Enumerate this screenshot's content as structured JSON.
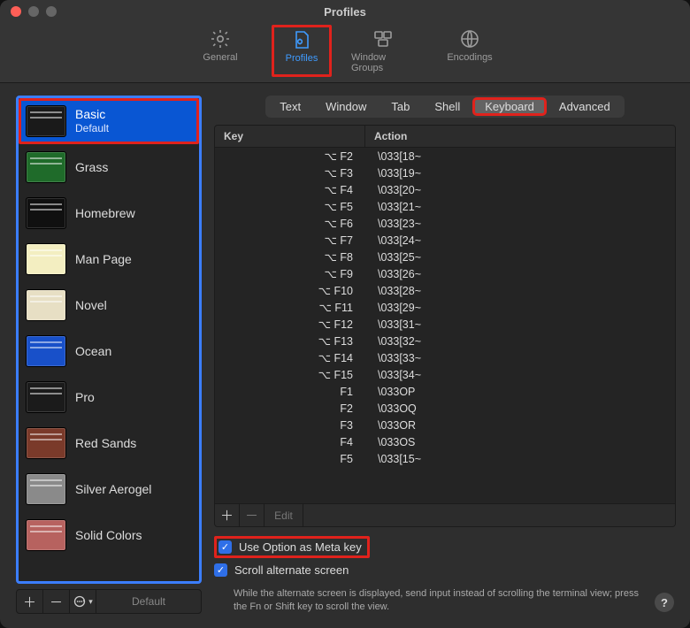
{
  "window": {
    "title": "Profiles"
  },
  "toolbar": [
    {
      "id": "general",
      "label": "General",
      "icon": "gear-icon",
      "active": false
    },
    {
      "id": "profiles",
      "label": "Profiles",
      "icon": "profile-icon",
      "active": true,
      "highlight": true
    },
    {
      "id": "window-groups",
      "label": "Window Groups",
      "icon": "wingroups-icon",
      "active": false
    },
    {
      "id": "encodings",
      "label": "Encodings",
      "icon": "globe-icon",
      "active": false
    }
  ],
  "profiles": [
    {
      "name": "Basic",
      "subtitle": "Default",
      "selected": true,
      "highlight": true,
      "thumb": "#1a1a1a"
    },
    {
      "name": "Grass",
      "thumb": "#1f6b2a"
    },
    {
      "name": "Homebrew",
      "thumb": "#101010"
    },
    {
      "name": "Man Page",
      "thumb": "#f3eec1"
    },
    {
      "name": "Novel",
      "thumb": "#e7dfc4"
    },
    {
      "name": "Ocean",
      "thumb": "#1850c9"
    },
    {
      "name": "Pro",
      "thumb": "#1b1b1b"
    },
    {
      "name": "Red Sands",
      "thumb": "#7a3a2a"
    },
    {
      "name": "Silver Aerogel",
      "thumb": "#8a8a8a"
    },
    {
      "name": "Solid Colors",
      "thumb": "#b7625f"
    }
  ],
  "listbar": {
    "default_label": "Default"
  },
  "tabs": [
    {
      "id": "text",
      "label": "Text"
    },
    {
      "id": "window",
      "label": "Window"
    },
    {
      "id": "tab",
      "label": "Tab"
    },
    {
      "id": "shell",
      "label": "Shell"
    },
    {
      "id": "keyboard",
      "label": "Keyboard",
      "active": true,
      "highlight": true
    },
    {
      "id": "advanced",
      "label": "Advanced"
    }
  ],
  "table": {
    "headers": {
      "key": "Key",
      "action": "Action"
    },
    "rows": [
      {
        "key": "⌥ F2",
        "action": "\\033[18~"
      },
      {
        "key": "⌥ F3",
        "action": "\\033[19~"
      },
      {
        "key": "⌥ F4",
        "action": "\\033[20~"
      },
      {
        "key": "⌥ F5",
        "action": "\\033[21~"
      },
      {
        "key": "⌥ F6",
        "action": "\\033[23~"
      },
      {
        "key": "⌥ F7",
        "action": "\\033[24~"
      },
      {
        "key": "⌥ F8",
        "action": "\\033[25~"
      },
      {
        "key": "⌥ F9",
        "action": "\\033[26~"
      },
      {
        "key": "⌥ F10",
        "action": "\\033[28~"
      },
      {
        "key": "⌥ F11",
        "action": "\\033[29~"
      },
      {
        "key": "⌥ F12",
        "action": "\\033[31~"
      },
      {
        "key": "⌥ F13",
        "action": "\\033[32~"
      },
      {
        "key": "⌥ F14",
        "action": "\\033[33~"
      },
      {
        "key": "⌥ F15",
        "action": "\\033[34~"
      },
      {
        "key": "F1",
        "action": "\\033OP"
      },
      {
        "key": "F2",
        "action": "\\033OQ"
      },
      {
        "key": "F3",
        "action": "\\033OR"
      },
      {
        "key": "F4",
        "action": "\\033OS"
      },
      {
        "key": "F5",
        "action": "\\033[15~"
      }
    ],
    "footer": {
      "edit_label": "Edit"
    }
  },
  "options": {
    "meta": {
      "label": "Use Option as Meta key",
      "checked": true,
      "highlight": true
    },
    "scroll": {
      "label": "Scroll alternate screen",
      "checked": true
    }
  },
  "hint": "While the alternate screen is displayed, send input instead of scrolling the terminal view; press the Fn or Shift key to scroll the view.",
  "help": "?"
}
